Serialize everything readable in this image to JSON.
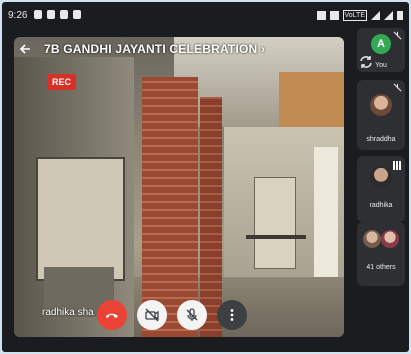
{
  "status_bar": {
    "time": "9:26",
    "right_text": "VoLTE"
  },
  "call": {
    "title": "7B GANDHI JAYANTI CELEBRATION",
    "title_chevron": "›",
    "rec_label": "REC",
    "presenter_name": "radhika sha"
  },
  "sidebar": {
    "self_initial": "A",
    "self_label": "You",
    "participants": [
      {
        "name": "shraddha"
      },
      {
        "name": "radhika"
      },
      {
        "name": "41 others"
      }
    ]
  },
  "controls": {
    "end_call": "end-call-icon",
    "camera_off": "camera-off-icon",
    "mic_off": "mic-off-icon",
    "more": "more-vert-icon"
  },
  "colors": {
    "end_call": "#ea4335",
    "rec": "#d93025",
    "self_avatar": "#34a853"
  }
}
